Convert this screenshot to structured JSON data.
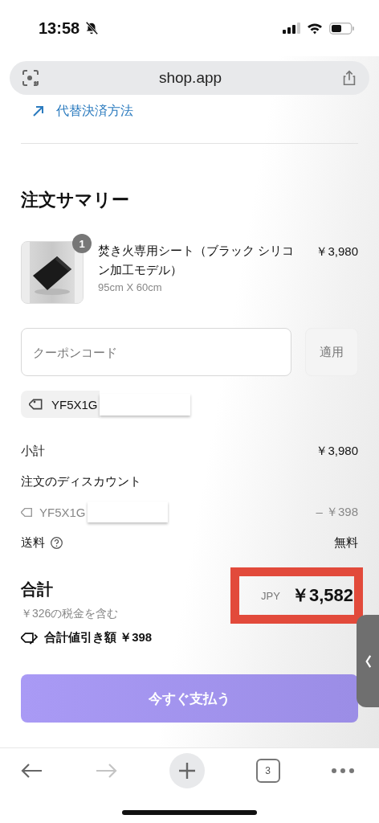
{
  "status_bar": {
    "time": "13:58",
    "silent": true
  },
  "address_bar": {
    "url": "shop.app"
  },
  "alternative_payment_link": "代替決済方法",
  "summary": {
    "title": "注文サマリー",
    "items": [
      {
        "quantity": "1",
        "name": "焚き火専用シート（ブラック シリコン加工モデル）",
        "variant": "95cm X 60cm",
        "price": "￥3,980"
      }
    ]
  },
  "coupon": {
    "placeholder": "クーポンコード",
    "apply_button": "適用",
    "applied_code": "YF5X1G"
  },
  "lines": [
    {
      "kind": "plain",
      "label": "小計",
      "value": "￥3,980"
    },
    {
      "kind": "discount",
      "label": "注文のディスカウント",
      "code": "YF5X1G",
      "value": "– ￥398"
    },
    {
      "kind": "help",
      "label": "送料",
      "value": "無料"
    }
  ],
  "total": {
    "label": "合計",
    "currency": "JPY",
    "amount": "￥3,582",
    "tax_note": "￥326の税金を含む",
    "savings": "合計値引き額 ￥398",
    "highlighted": true
  },
  "pay_button": "今すぐ支払う",
  "browser_toolbar": {
    "tab_count": "3",
    "forward_disabled": true
  }
}
